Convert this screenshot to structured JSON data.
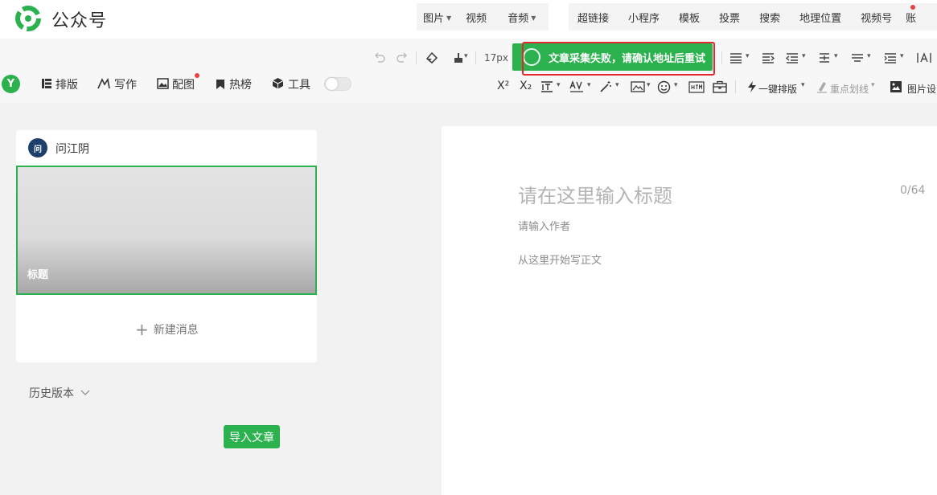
{
  "header": {
    "logo_text": "公众号",
    "menu_group1": [
      {
        "label": "图片",
        "caret": "▼"
      },
      {
        "label": "视频",
        "caret": ""
      },
      {
        "label": "音频",
        "caret": "▼"
      }
    ],
    "menu_group2": [
      {
        "label": "超链接"
      },
      {
        "label": "小程序"
      },
      {
        "label": "模板"
      },
      {
        "label": "投票"
      },
      {
        "label": "搜索"
      },
      {
        "label": "地理位置"
      },
      {
        "label": "视频号"
      },
      {
        "label": "账"
      }
    ]
  },
  "toolbar": {
    "font_size": "17px",
    "one_click_layout": "一键排版",
    "highlight_line": "重点划线",
    "image_settings": "图片设",
    "caret": "▾"
  },
  "toast": {
    "message": "文章采集失败，请确认地址后重试"
  },
  "plugin_nav": {
    "logo": "Y",
    "items": [
      {
        "label": "排版"
      },
      {
        "label": "写作"
      },
      {
        "label": "配图"
      },
      {
        "label": "热榜"
      },
      {
        "label": "工具"
      }
    ]
  },
  "left_panel": {
    "account_name": "问江阴",
    "avatar_text": "问",
    "cover_title": "标题",
    "new_message": "新建消息",
    "plus": "+",
    "history": "历史版本",
    "import_button": "导入文章"
  },
  "editor": {
    "title_placeholder": "请在这里输入标题",
    "title_count": "0/64",
    "author_placeholder": "请输入作者",
    "body_placeholder": "从这里开始写正文"
  },
  "colors": {
    "brand_green": "#2bb24f",
    "alert_red": "#e4262d",
    "badge_red": "#e64340"
  }
}
